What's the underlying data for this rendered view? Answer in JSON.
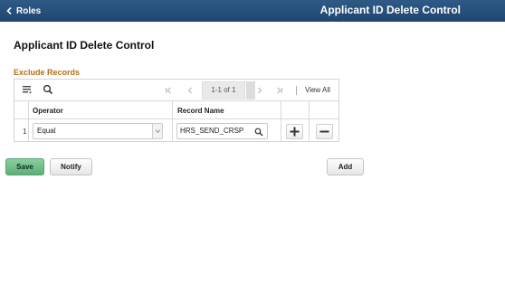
{
  "header": {
    "back_label": "Roles",
    "title": "Applicant ID Delete Control",
    "bar_color": "#24507c"
  },
  "page": {
    "title": "Applicant ID Delete Control"
  },
  "exclude_records": {
    "section_title": "Exclude Records",
    "section_color": "#b56d12",
    "toolbar": {
      "icons": [
        "grid-personalize-icon",
        "find-icon"
      ],
      "pager_icons": [
        "first-page-icon",
        "previous-page-icon",
        "next-page-icon",
        "last-page-icon"
      ],
      "pager_text": "1-1 of 1",
      "view_all": "View All"
    },
    "columns": [
      "Operator",
      "Record Name"
    ],
    "rows": [
      {
        "num": "1",
        "operator": "Equal",
        "record_name": "HRS_SEND_CRSP",
        "actions": [
          "add-row",
          "delete-row"
        ]
      }
    ]
  },
  "footer": {
    "save_label": "Save",
    "notify_label": "Notify",
    "add_label": "Add",
    "save_color": "#6fbe88"
  }
}
